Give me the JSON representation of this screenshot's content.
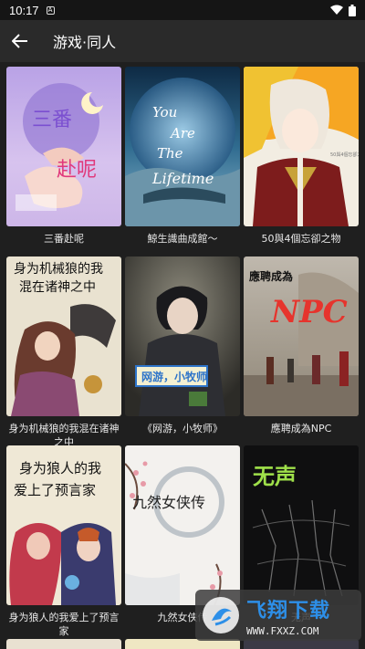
{
  "status": {
    "time": "10:17"
  },
  "header": {
    "title": "游戏·同人"
  },
  "books": [
    {
      "title": "三番赴呢"
    },
    {
      "title": "鯨生識曲成館〜"
    },
    {
      "title": "50與4個忘卻之物"
    },
    {
      "title": "身为机械狼的我混在诸神之中"
    },
    {
      "title": "《网游，小牧师》"
    },
    {
      "title": "應聘成為NPC"
    },
    {
      "title": "身为狼人的我爱上了预言家"
    },
    {
      "title": "九然女侠传"
    },
    {
      "title": "无声"
    }
  ],
  "covers": {
    "c1_text": "三番赴呢",
    "c2_text": "You Are The Lifetime",
    "c4_text": "身为机械狼的我混在诸神之中",
    "c5_text": "网游，小牧师",
    "c6_text": "應聘成為NPC",
    "c7_text": "身为狼人的我爱上了预言家",
    "c8_text": "九然女侠传",
    "c9_text": "无声"
  },
  "watermark": {
    "brand": "飞翔下载",
    "url": "WWW.FXXZ.COM"
  }
}
